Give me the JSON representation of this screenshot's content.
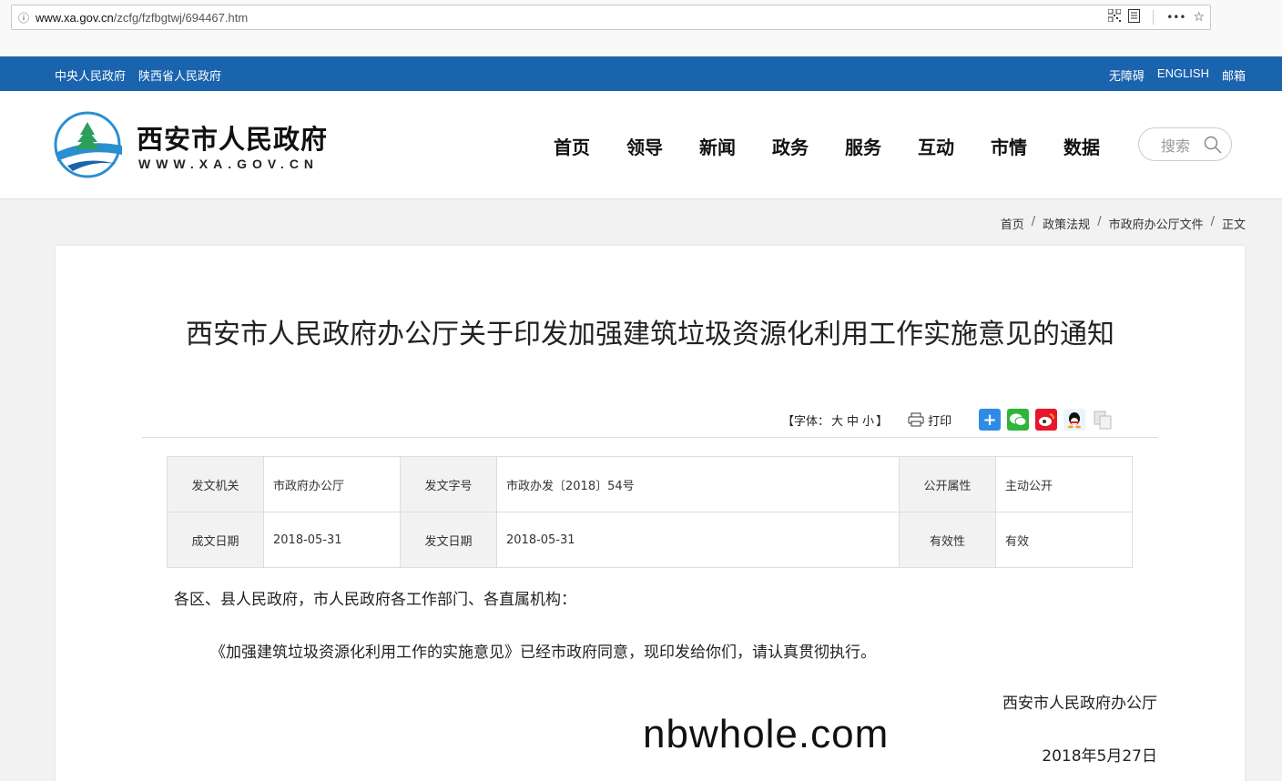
{
  "browser": {
    "url_host": "www.xa.gov.cn",
    "url_path": "/zcfg/fzfbgtwj/694467.htm",
    "icons": [
      "info-icon",
      "qrcode-icon",
      "reader-icon",
      "more-icon",
      "star-icon"
    ],
    "more_label": "•••"
  },
  "topbar": {
    "left_links": [
      "中央人民政府",
      "陕西省人民政府"
    ],
    "right_links": [
      "无障碍",
      "ENGLISH",
      "邮箱"
    ],
    "bg_color": "#1a63ad"
  },
  "header": {
    "site_name": "西安市人民政府",
    "site_url": "WWW.XA.GOV.CN",
    "nav": [
      "首页",
      "领导",
      "新闻",
      "政务",
      "服务",
      "互动",
      "市情",
      "数据"
    ],
    "search_label": "搜索"
  },
  "breadcrumb": [
    "首页",
    "政策法规",
    "市政府办公厅文件",
    "正文"
  ],
  "article": {
    "title": "西安市人民政府办公厅关于印发加强建筑垃圾资源化利用工作实施意见的通知",
    "font_ctl": {
      "open": "【字体：",
      "large": "大",
      "medium": "中",
      "small": "小",
      "close": "】"
    },
    "print_label": "打印",
    "meta": {
      "issuer_label": "发文机关",
      "issuer": "市政府办公厅",
      "doc_no_label": "发文字号",
      "doc_no": "市政办发〔2018〕54号",
      "public_label": "公开属性",
      "public": "主动公开",
      "created_label": "成文日期",
      "created": "2018-05-31",
      "issued_label": "发文日期",
      "issued": "2018-05-31",
      "valid_label": "有效性",
      "valid": "有效"
    },
    "salutation": "各区、县人民政府，市人民政府各工作部门、各直属机构：",
    "paragraph": "《加强建筑垃圾资源化利用工作的实施意见》已经市政府同意，现印发给你们，请认真贯彻执行。",
    "signature": "西安市人民政府办公厅",
    "date": "2018年5月27日",
    "watermark": "nbwhole.com"
  }
}
